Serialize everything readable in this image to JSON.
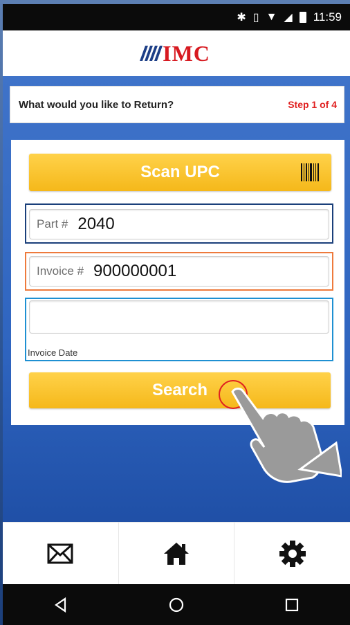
{
  "status_bar": {
    "time": "11:59"
  },
  "header": {
    "logo_text": "IMC"
  },
  "step": {
    "title": "What would you like to Return?",
    "counter": "Step 1 of 4"
  },
  "form": {
    "scan_label": "Scan UPC",
    "part_label": "Part #",
    "part_value": "2040",
    "invoice_label": "Invoice #",
    "invoice_value": "900000001",
    "date_label": "Invoice Date",
    "date_value": "",
    "search_label": "Search"
  },
  "bottom_nav": {
    "items": [
      "mail-icon",
      "home-icon",
      "gear-icon"
    ]
  },
  "system_nav": {
    "items": [
      "back-icon",
      "home-circle-icon",
      "recents-icon"
    ]
  },
  "colors": {
    "brand_red": "#d71920",
    "brand_blue": "#1d3f87",
    "button_yellow": "#f5b81a",
    "background_blue": "#2f65c0"
  }
}
